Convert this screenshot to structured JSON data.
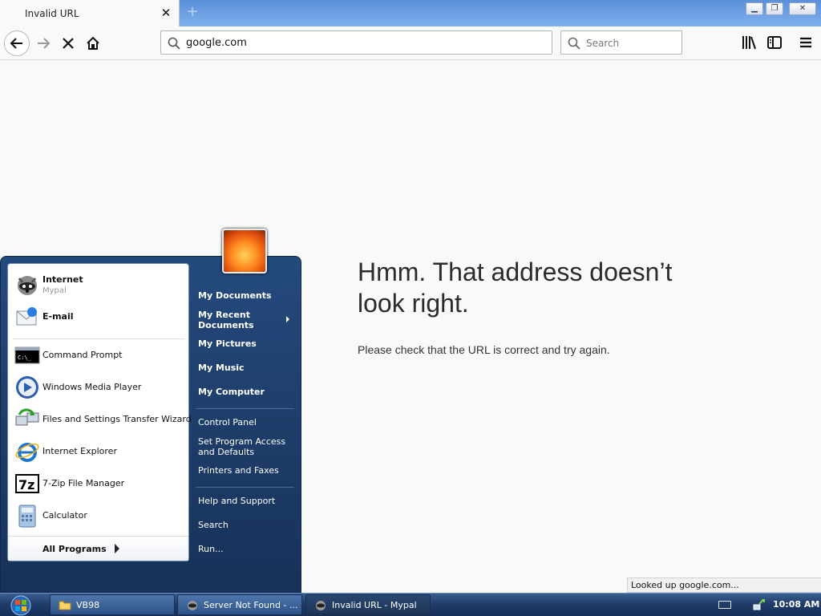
{
  "browser": {
    "tab": {
      "title": "Invalid URL"
    },
    "url": "google.com",
    "search_placeholder": "Search",
    "status": "Looked up google.com..."
  },
  "error_page": {
    "title": "Hmm. That address doesn’t look right.",
    "message": "Please check that the URL is correct and try again."
  },
  "start_menu": {
    "pinned": [
      {
        "label": "Internet",
        "sub": "Mypal",
        "icon": "raccoon-browser-icon"
      },
      {
        "label": "E-mail",
        "icon": "email-envelope-icon"
      }
    ],
    "recent": [
      {
        "label": "Command Prompt",
        "icon": "command-prompt-icon"
      },
      {
        "label": "Windows Media Player",
        "icon": "media-player-icon"
      },
      {
        "label": "Files and Settings Transfer Wizard",
        "icon": "transfer-wizard-icon"
      },
      {
        "label": "Internet Explorer",
        "icon": "internet-explorer-icon"
      },
      {
        "label": "7-Zip File Manager",
        "icon": "7zip-icon"
      },
      {
        "label": "Calculator",
        "icon": "calculator-icon"
      }
    ],
    "all_programs": "All Programs",
    "right_pane": {
      "documents": "My Documents",
      "recent_docs": "My Recent Documents",
      "pictures": "My Pictures",
      "music": "My Music",
      "computer": "My Computer",
      "control_panel": "Control Panel",
      "program_access": "Set Program Access and Defaults",
      "printers": "Printers and Faxes",
      "help": "Help and Support",
      "search": "Search",
      "run": "Run..."
    }
  },
  "taskbar": {
    "tasks": [
      {
        "label": "VB98",
        "icon": "folder-icon"
      },
      {
        "label": "Server Not Found - ...",
        "icon": "raccoon-browser-icon"
      },
      {
        "label": "Invalid URL - Mypal",
        "icon": "raccoon-browser-icon"
      }
    ],
    "clock": "10:08 AM"
  }
}
